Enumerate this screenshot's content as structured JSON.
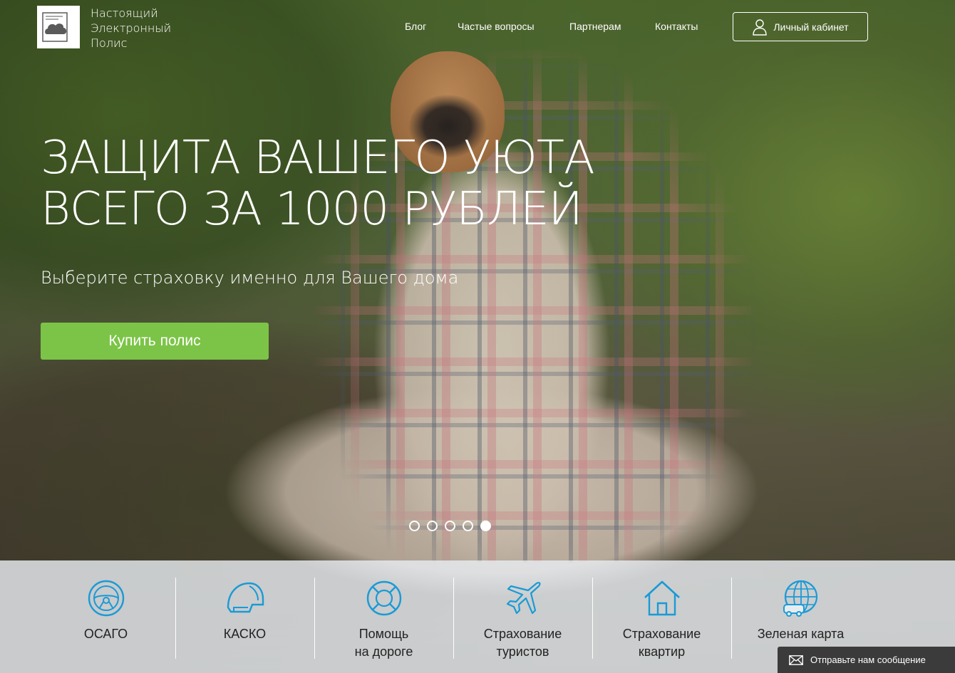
{
  "logo": {
    "line1": "Настоящий",
    "line2": "Электронный",
    "line3": "Полис"
  },
  "nav": {
    "items": [
      {
        "label": "Блог"
      },
      {
        "label": "Частые вопросы"
      },
      {
        "label": "Партнерам"
      },
      {
        "label": "Контакты"
      }
    ],
    "cabinet_label": "Личный кабинет"
  },
  "hero": {
    "headline_line1": "ЗАЩИТА ВАШЕГО УЮТА",
    "headline_line2": "ВСЕГО ЗА 1000 РУБЛЕЙ",
    "subline": "Выберите страховку именно для Вашего дома",
    "cta_label": "Купить полис",
    "slide_count": 5,
    "active_slide": 5
  },
  "services": [
    {
      "label": "ОСАГО",
      "icon": "steering-wheel-icon"
    },
    {
      "label": "КАСКО",
      "icon": "helmet-icon"
    },
    {
      "label": "Помощь\nна дороге",
      "icon": "lifebuoy-icon"
    },
    {
      "label": "Страхование\nтуристов",
      "icon": "airplane-icon"
    },
    {
      "label": "Страхование\nквартир",
      "icon": "house-icon"
    },
    {
      "label": "Зеленая карта",
      "icon": "globe-car-icon"
    }
  ],
  "chat": {
    "label": "Отправьте нам сообщение"
  },
  "colors": {
    "accent_green": "#7cc447",
    "icon_blue": "#1a9ad6"
  }
}
